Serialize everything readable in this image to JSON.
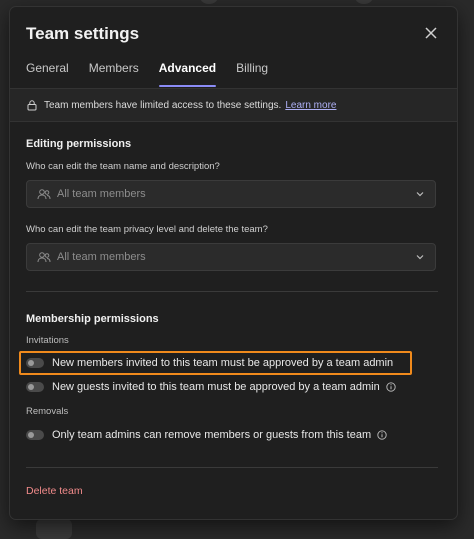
{
  "modal": {
    "title": "Team settings",
    "close_icon": "close-icon"
  },
  "tabs": [
    {
      "label": "General",
      "active": false
    },
    {
      "label": "Members",
      "active": false
    },
    {
      "label": "Advanced",
      "active": true
    },
    {
      "label": "Billing",
      "active": false
    }
  ],
  "banner": {
    "icon": "lock-icon",
    "text": "Team members have limited access to these settings.",
    "link": "Learn more"
  },
  "editing": {
    "title": "Editing permissions",
    "name_question": "Who can edit the team name and description?",
    "name_value": "All team members",
    "privacy_question": "Who can edit the team privacy level and delete the team?",
    "privacy_value": "All team members"
  },
  "membership": {
    "title": "Membership permissions",
    "invitations_label": "Invitations",
    "toggle1": {
      "label": "New members invited to this team must be approved by a team admin",
      "on": false
    },
    "toggle2": {
      "label": "New guests invited to this team must be approved by a team admin",
      "on": false
    },
    "removals_label": "Removals",
    "toggle3": {
      "label": "Only team admins can remove members or guests from this team",
      "on": false
    }
  },
  "delete_label": "Delete team",
  "colors": {
    "accent": "#8b8cf7",
    "highlight": "#f08a1c",
    "danger": "#f28b8b"
  }
}
